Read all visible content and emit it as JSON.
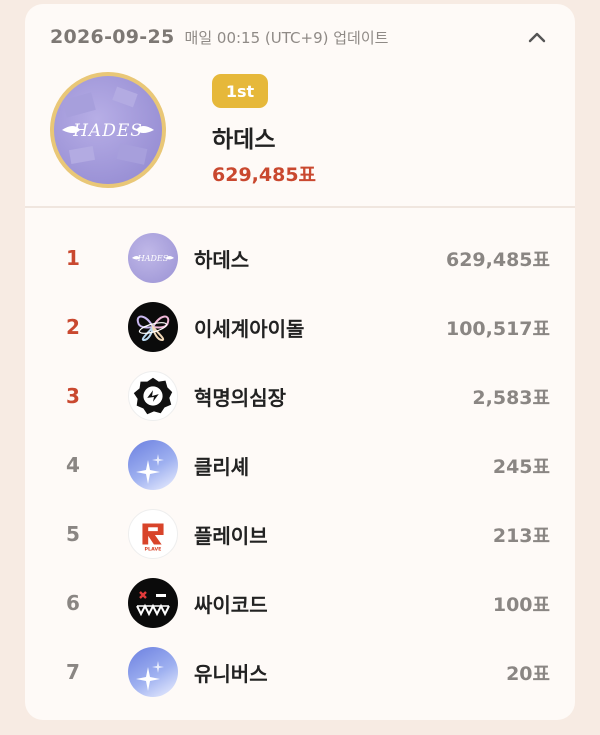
{
  "header": {
    "date": "2026-09-25",
    "update_text": "매일 00:15 (UTC+9) 업데이트"
  },
  "winner": {
    "badge": "1st",
    "name": "하데스",
    "votes": "629,485표",
    "logo_text": "HADES"
  },
  "rankings": [
    {
      "rank": "1",
      "name": "하데스",
      "votes": "629,485표",
      "avatar": "hades-logo",
      "logo_text": "HADES"
    },
    {
      "rank": "2",
      "name": "이세계아이돌",
      "votes": "100,517표",
      "avatar": "butterfly-logo"
    },
    {
      "rank": "3",
      "name": "혁명의심장",
      "votes": "2,583표",
      "avatar": "gear-heart-logo"
    },
    {
      "rank": "4",
      "name": "클리셰",
      "votes": "245표",
      "avatar": "sparkle-logo"
    },
    {
      "rank": "5",
      "name": "플레이브",
      "votes": "213표",
      "avatar": "plave-logo",
      "logo_text": "PLAVE"
    },
    {
      "rank": "6",
      "name": "싸이코드",
      "votes": "100표",
      "avatar": "smile-face-logo"
    },
    {
      "rank": "7",
      "name": "유니버스",
      "votes": "20표",
      "avatar": "sparkle-logo"
    }
  ],
  "colors": {
    "background": "#f7ebe3",
    "card": "#fefaf7",
    "accent_red": "#c9482f",
    "badge_gold": "#e6b83a",
    "muted": "#8a8683"
  }
}
